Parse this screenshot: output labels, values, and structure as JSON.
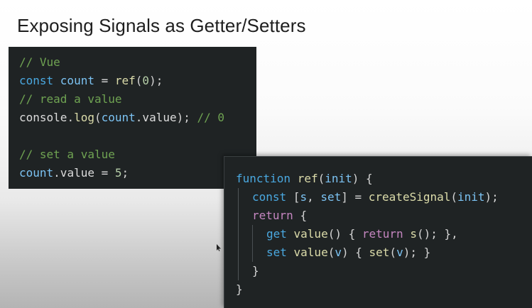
{
  "slide": {
    "title": "Exposing Signals as Getter/Setters"
  },
  "vue_panel": {
    "lines": [
      {
        "tokens": [
          {
            "t": "// Vue",
            "k": "comment"
          }
        ]
      },
      {
        "tokens": [
          {
            "t": "const ",
            "k": "kw"
          },
          {
            "t": "count",
            "k": "var"
          },
          {
            "t": " = ",
            "k": "plain"
          },
          {
            "t": "ref",
            "k": "fn"
          },
          {
            "t": "(",
            "k": "punc"
          },
          {
            "t": "0",
            "k": "num"
          },
          {
            "t": ");",
            "k": "punc"
          }
        ]
      },
      {
        "tokens": [
          {
            "t": "// read a value",
            "k": "comment"
          }
        ]
      },
      {
        "tokens": [
          {
            "t": "console",
            "k": "plain"
          },
          {
            "t": ".",
            "k": "punc"
          },
          {
            "t": "log",
            "k": "fn"
          },
          {
            "t": "(",
            "k": "punc"
          },
          {
            "t": "count",
            "k": "var"
          },
          {
            "t": ".value",
            "k": "plain"
          },
          {
            "t": "); ",
            "k": "punc"
          },
          {
            "t": "// 0",
            "k": "comment"
          }
        ]
      },
      {
        "tokens": [
          {
            "t": " ",
            "k": "plain"
          }
        ]
      },
      {
        "tokens": [
          {
            "t": "// set a value",
            "k": "comment"
          }
        ]
      },
      {
        "tokens": [
          {
            "t": "count",
            "k": "var"
          },
          {
            "t": ".value = ",
            "k": "plain"
          },
          {
            "t": "5",
            "k": "num"
          },
          {
            "t": ";",
            "k": "punc"
          }
        ]
      }
    ]
  },
  "impl_panel": {
    "lines": [
      {
        "indent": 0,
        "tokens": [
          {
            "t": "function ",
            "k": "kw"
          },
          {
            "t": "ref",
            "k": "fn"
          },
          {
            "t": "(",
            "k": "punc"
          },
          {
            "t": "init",
            "k": "var"
          },
          {
            "t": ") {",
            "k": "punc"
          }
        ]
      },
      {
        "indent": 1,
        "tokens": [
          {
            "t": "const ",
            "k": "kw"
          },
          {
            "t": "[",
            "k": "punc"
          },
          {
            "t": "s",
            "k": "var"
          },
          {
            "t": ", ",
            "k": "punc"
          },
          {
            "t": "set",
            "k": "var"
          },
          {
            "t": "] = ",
            "k": "punc"
          },
          {
            "t": "createSignal",
            "k": "fn"
          },
          {
            "t": "(",
            "k": "punc"
          },
          {
            "t": "init",
            "k": "var"
          },
          {
            "t": ");",
            "k": "punc"
          }
        ]
      },
      {
        "indent": 1,
        "tokens": [
          {
            "t": "return ",
            "k": "kw2"
          },
          {
            "t": "{",
            "k": "punc"
          }
        ]
      },
      {
        "indent": 2,
        "tokens": [
          {
            "t": "get ",
            "k": "kw"
          },
          {
            "t": "value",
            "k": "fn"
          },
          {
            "t": "() { ",
            "k": "punc"
          },
          {
            "t": "return ",
            "k": "kw2"
          },
          {
            "t": "s",
            "k": "fn"
          },
          {
            "t": "(); },",
            "k": "punc"
          }
        ]
      },
      {
        "indent": 2,
        "tokens": [
          {
            "t": "set ",
            "k": "kw"
          },
          {
            "t": "value",
            "k": "fn"
          },
          {
            "t": "(",
            "k": "punc"
          },
          {
            "t": "v",
            "k": "var"
          },
          {
            "t": ") { ",
            "k": "punc"
          },
          {
            "t": "set",
            "k": "fn"
          },
          {
            "t": "(",
            "k": "punc"
          },
          {
            "t": "v",
            "k": "var"
          },
          {
            "t": "); }",
            "k": "punc"
          }
        ]
      },
      {
        "indent": 1,
        "tokens": [
          {
            "t": "}",
            "k": "punc"
          }
        ]
      },
      {
        "indent": 0,
        "tokens": [
          {
            "t": "}",
            "k": "punc"
          }
        ]
      }
    ]
  },
  "cursor": {
    "icon": "mouse-pointer-icon"
  }
}
